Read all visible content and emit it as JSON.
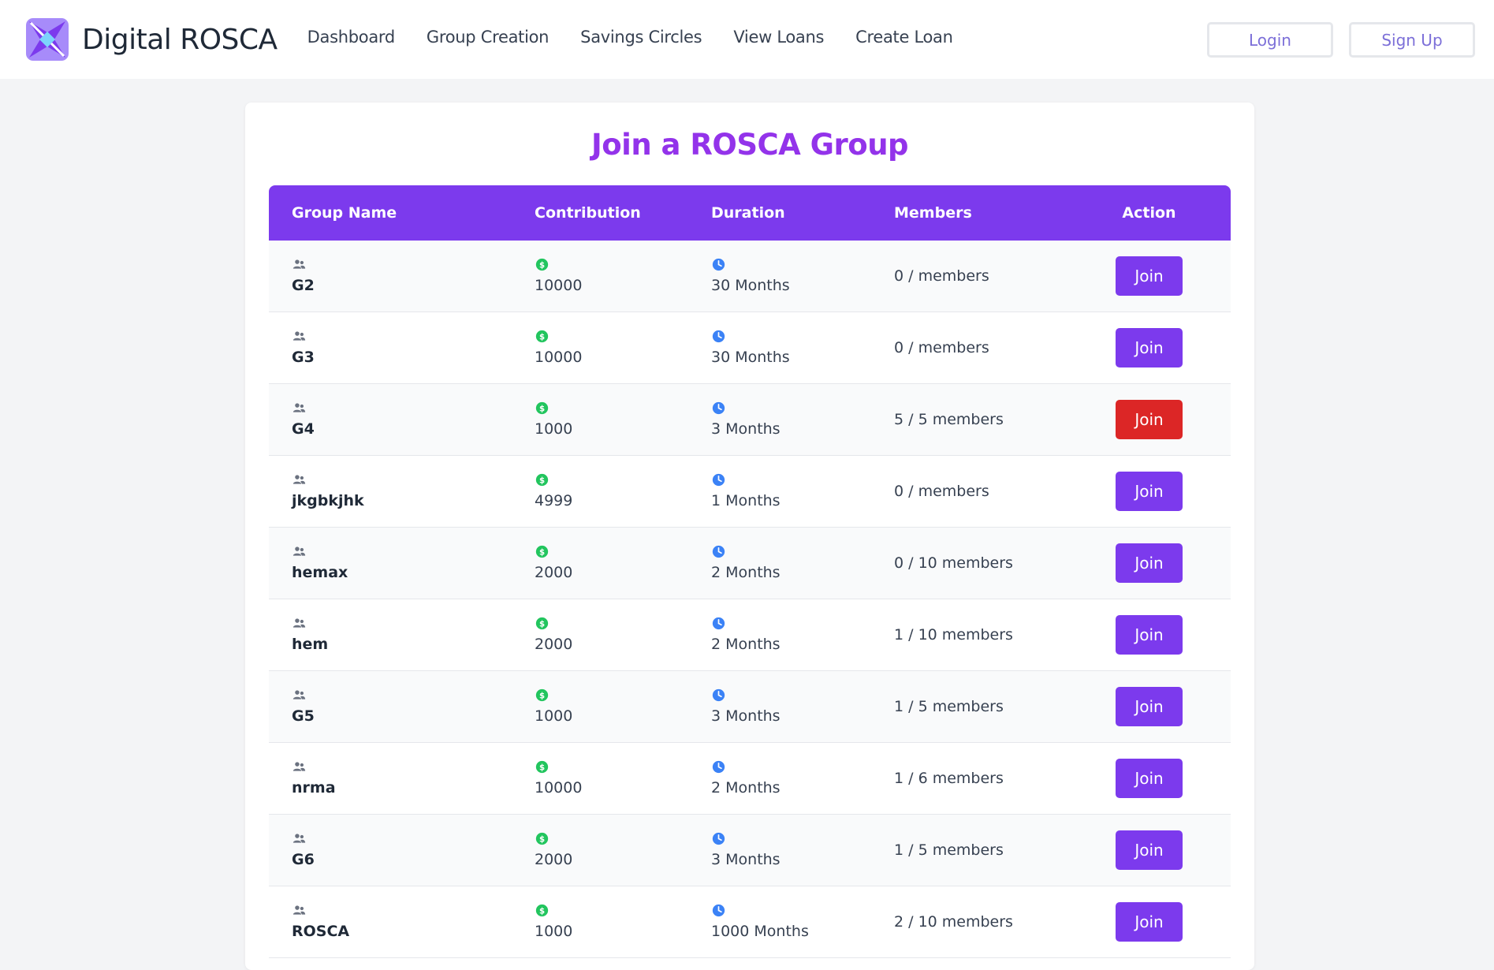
{
  "brand": {
    "name": "Digital ROSCA"
  },
  "nav": [
    "Dashboard",
    "Group Creation",
    "Savings Circles",
    "View Loans",
    "Create Loan"
  ],
  "auth": {
    "login": "Login",
    "signup": "Sign Up"
  },
  "page": {
    "title": "Join a ROSCA Group"
  },
  "table": {
    "headers": [
      "Group Name",
      "Contribution",
      "Duration",
      "Members",
      "Action"
    ],
    "rows": [
      {
        "name": "G2",
        "contribution": "10000",
        "duration": "30 Months",
        "members": "0 / members",
        "action": "Join",
        "full": false
      },
      {
        "name": "G3",
        "contribution": "10000",
        "duration": "30 Months",
        "members": "0 / members",
        "action": "Join",
        "full": false
      },
      {
        "name": "G4",
        "contribution": "1000",
        "duration": "3 Months",
        "members": "5 / 5 members",
        "action": "Join",
        "full": true
      },
      {
        "name": "jkgbkjhk",
        "contribution": "4999",
        "duration": "1 Months",
        "members": "0 / members",
        "action": "Join",
        "full": false
      },
      {
        "name": "hemax",
        "contribution": "2000",
        "duration": "2 Months",
        "members": "0 / 10 members",
        "action": "Join",
        "full": false
      },
      {
        "name": "hem",
        "contribution": "2000",
        "duration": "2 Months",
        "members": "1 / 10 members",
        "action": "Join",
        "full": false
      },
      {
        "name": "G5",
        "contribution": "1000",
        "duration": "3 Months",
        "members": "1 / 5 members",
        "action": "Join",
        "full": false
      },
      {
        "name": "nrma",
        "contribution": "10000",
        "duration": "2 Months",
        "members": "1 / 6 members",
        "action": "Join",
        "full": false
      },
      {
        "name": "G6",
        "contribution": "2000",
        "duration": "3 Months",
        "members": "1 / 5 members",
        "action": "Join",
        "full": false
      },
      {
        "name": "ROSCA",
        "contribution": "1000",
        "duration": "1000 Months",
        "members": "2 / 10 members",
        "action": "Join",
        "full": false
      }
    ]
  },
  "icons": {
    "group": "users-icon",
    "contribution": "dollar-icon",
    "duration": "clock-icon"
  },
  "colors": {
    "accent": "#7c3aed",
    "title": "#9333ea",
    "full": "#dc2626",
    "dollar": "#22c55e",
    "clock": "#3b82f6"
  }
}
